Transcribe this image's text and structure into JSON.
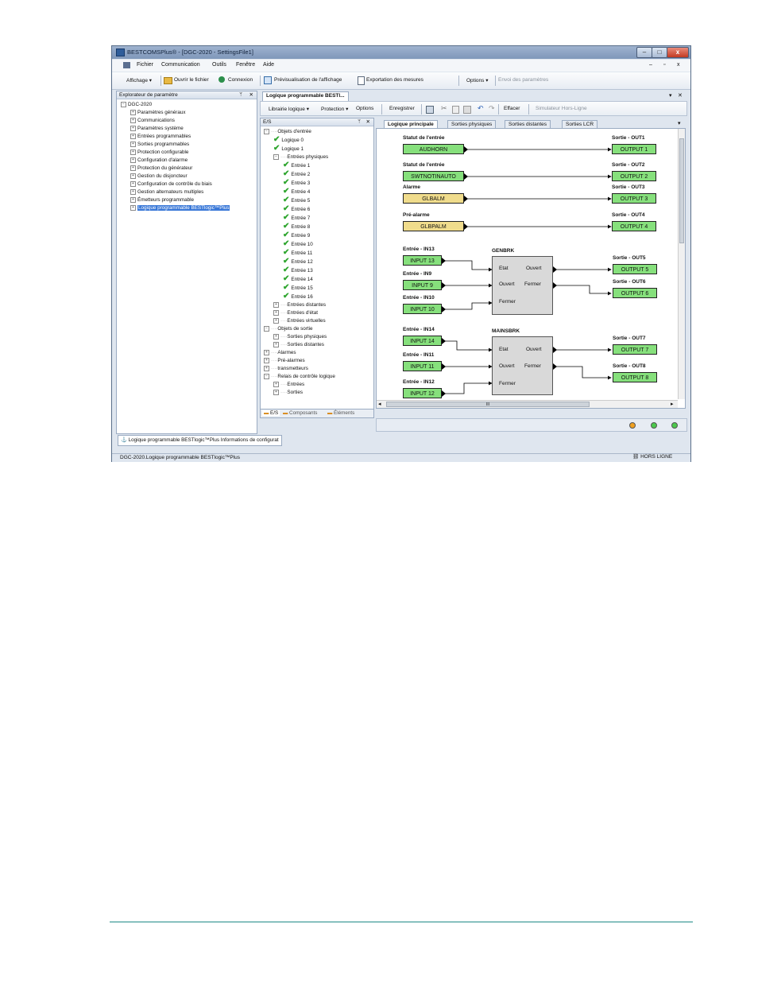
{
  "window": {
    "title": "BESTCOMSPlus® - [DGC-2020 - SettingsFile1]",
    "buttons": {
      "minimize": "–",
      "maximize": "□",
      "close": "x"
    },
    "mdi_buttons": {
      "minimize": "–",
      "restore": "▫",
      "close": "x"
    }
  },
  "menu": [
    "Fichier",
    "Communication",
    "Outils",
    "Fenêtre",
    "Aide"
  ],
  "toolbar": {
    "affichage": "Affichage",
    "ouvrir": "Ouvrir le fichier",
    "connexion": "Connexion",
    "previsualisation": "Prévisualisation de l'affichage",
    "exportation": "Exportation des mesures",
    "options": "Options",
    "envoi": "Envoi des paramètres"
  },
  "explorer": {
    "title": "Explorateur de paramètre",
    "pin": "ᛘ",
    "close": "✕",
    "root": "DGC-2020",
    "items": [
      "Paramètres généraux",
      "Communications",
      "Paramètres système",
      "Entrées programmables",
      "Sorties programmables",
      "Protection configurable",
      "Configuration d'alarme",
      "Protection du générateur",
      "Gestion du disjoncteur",
      "Configuration de contrôle du biais",
      "Gestion alternateurs multiples",
      "Émetteurs programmable",
      "Logique programmable BESTlogic™Plus"
    ]
  },
  "doc_tab": {
    "label": "Logique programmable BESTl...",
    "pin": "▾",
    "close": "✕"
  },
  "logic_toolbar": {
    "librairie": "Librairie logique",
    "protection": "Protection",
    "options": "Options",
    "enregistrer": "Enregistrer",
    "effacer": "Effacer",
    "simulateur": "Simulateur Hors-Ligne"
  },
  "io_panel": {
    "title": "E/S",
    "pin": "ᛘ",
    "close": "✕",
    "items": [
      {
        "label": "Objets d'entrée",
        "level": 0,
        "type": "group",
        "open": true
      },
      {
        "label": "Logique 0",
        "level": 1,
        "type": "check"
      },
      {
        "label": "Logique 1",
        "level": 1,
        "type": "check"
      },
      {
        "label": "Entrées physiques",
        "level": 1,
        "type": "group",
        "open": true
      },
      {
        "label": "Entrée 1",
        "level": 2,
        "type": "check"
      },
      {
        "label": "Entrée 2",
        "level": 2,
        "type": "check"
      },
      {
        "label": "Entrée 3",
        "level": 2,
        "type": "check"
      },
      {
        "label": "Entrée 4",
        "level": 2,
        "type": "check"
      },
      {
        "label": "Entrée 5",
        "level": 2,
        "type": "check"
      },
      {
        "label": "Entrée 6",
        "level": 2,
        "type": "check"
      },
      {
        "label": "Entrée 7",
        "level": 2,
        "type": "check"
      },
      {
        "label": "Entrée 8",
        "level": 2,
        "type": "check"
      },
      {
        "label": "Entrée 9",
        "level": 2,
        "type": "check"
      },
      {
        "label": "Entrée 10",
        "level": 2,
        "type": "check"
      },
      {
        "label": "Entrée 11",
        "level": 2,
        "type": "check"
      },
      {
        "label": "Entrée 12",
        "level": 2,
        "type": "check"
      },
      {
        "label": "Entrée 13",
        "level": 2,
        "type": "check"
      },
      {
        "label": "Entrée 14",
        "level": 2,
        "type": "check"
      },
      {
        "label": "Entrée 15",
        "level": 2,
        "type": "check"
      },
      {
        "label": "Entrée 16",
        "level": 2,
        "type": "check"
      },
      {
        "label": "Entrées distantes",
        "level": 1,
        "type": "group",
        "open": false
      },
      {
        "label": "Entrées d'état",
        "level": 1,
        "type": "group",
        "open": false
      },
      {
        "label": "Entrées virtuelles",
        "level": 1,
        "type": "group",
        "open": false
      },
      {
        "label": "Objets de sortie",
        "level": 0,
        "type": "group",
        "open": true
      },
      {
        "label": "Sorties physiques",
        "level": 1,
        "type": "group",
        "open": false
      },
      {
        "label": "Sorties distantes",
        "level": 1,
        "type": "group",
        "open": false
      },
      {
        "label": "Alarmes",
        "level": 0,
        "type": "group",
        "open": false
      },
      {
        "label": "Pré-alarmes",
        "level": 0,
        "type": "group",
        "open": false
      },
      {
        "label": "transmetteurs",
        "level": 0,
        "type": "group",
        "open": false
      },
      {
        "label": "Relais de contrôle logique",
        "level": 0,
        "type": "group",
        "open": true
      },
      {
        "label": "Entrées",
        "level": 1,
        "type": "group",
        "open": false
      },
      {
        "label": "Sorties",
        "level": 1,
        "type": "group",
        "open": false
      }
    ],
    "bottom_tabs": [
      "E/S",
      "Composants",
      "Éléments"
    ]
  },
  "canvas_tabs": [
    "Logique principale",
    "Sorties physiques",
    "Sorties distantes",
    "Sorties LCR"
  ],
  "canvas": {
    "rows": [
      {
        "in_title": "Statut de l'entrée",
        "in_box": "AUDHORN",
        "in_color": "green",
        "out_title": "Sortie - OUT1",
        "out_box": "OUTPUT 1"
      },
      {
        "in_title": "Statut de l'entrée",
        "in_box": "SWTNOTINAUTO",
        "in_color": "green",
        "out_title": "Sortie - OUT2",
        "out_box": "OUTPUT 2"
      },
      {
        "in_title": "Alarme",
        "in_box": "GLBALM",
        "in_color": "yellow",
        "out_title": "Sortie - OUT3",
        "out_box": "OUTPUT 3"
      },
      {
        "in_title": "Pré-alarme",
        "in_box": "GLBPALM",
        "in_color": "yellow",
        "out_title": "Sortie - OUT4",
        "out_box": "OUTPUT 4"
      }
    ],
    "genbrk": {
      "name": "GENBRK",
      "inputs": [
        {
          "title": "Entrée - IN13",
          "box": "INPUT 13"
        },
        {
          "title": "Entrée - IN9",
          "box": "INPUT 9"
        },
        {
          "title": "Entrée - IN10",
          "box": "INPUT 10"
        }
      ],
      "ports_in": [
        "Etat",
        "Ouvert",
        "Fermer"
      ],
      "ports_out": [
        "Ouvert",
        "Fermer"
      ],
      "outputs": [
        {
          "title": "Sortie - OUT5",
          "box": "OUTPUT 5"
        },
        {
          "title": "Sortie - OUT6",
          "box": "OUTPUT 6"
        }
      ]
    },
    "mainsbrk": {
      "name": "MAINSBRK",
      "inputs": [
        {
          "title": "Entrée - IN14",
          "box": "INPUT 14"
        },
        {
          "title": "Entrée - IN11",
          "box": "INPUT 11"
        },
        {
          "title": "Entrée - IN12",
          "box": "INPUT 12"
        }
      ],
      "ports_in": [
        "Etat",
        "Ouvert",
        "Fermer"
      ],
      "ports_out": [
        "Ouvert",
        "Fermer"
      ],
      "outputs": [
        {
          "title": "Sortie - OUT7",
          "box": "OUTPUT 7"
        },
        {
          "title": "Sortie - OUT8",
          "box": "OUTPUT 8"
        }
      ]
    },
    "scroll_mark": "III"
  },
  "leds": {
    "colors": [
      "#f0a020",
      "#4cc94c",
      "#4cc94c"
    ]
  },
  "bottom_tab": "Logique programmable BESTlogic™Plus  Informations de configurat",
  "status": {
    "path": "DGC-2020.Logique programmable BESTlogic™Plus",
    "connection": "HORS LIGNE"
  },
  "colors": {
    "green_box": "#86e07c",
    "yellow_box": "#f0dc8c",
    "selection": "#3b79d8",
    "footer_rule": "#1d8a86"
  }
}
